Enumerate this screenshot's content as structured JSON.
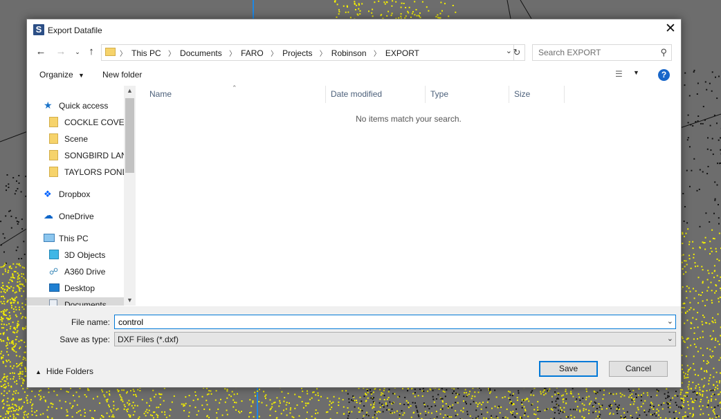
{
  "window": {
    "title": "Export Datafile",
    "app_icon_letter": "S",
    "close_glyph": "✕"
  },
  "address": {
    "crumbs": [
      "This PC",
      "Documents",
      "FARO",
      "Projects",
      "Robinson",
      "EXPORT"
    ]
  },
  "search": {
    "placeholder": "Search EXPORT"
  },
  "toolbar": {
    "organize_label": "Organize",
    "new_folder_label": "New folder",
    "help_label": "?"
  },
  "nav": {
    "items": [
      {
        "label": "Quick access",
        "icon": "star-icon"
      },
      {
        "label": "COCKLE COVE R",
        "icon": "folder-icon"
      },
      {
        "label": "Scene",
        "icon": "folder-icon"
      },
      {
        "label": "SONGBIRD LANE",
        "icon": "folder-icon"
      },
      {
        "label": "TAYLORS POND",
        "icon": "folder-icon"
      },
      {
        "label": "Dropbox",
        "icon": "dropbox-icon"
      },
      {
        "label": "OneDrive",
        "icon": "cloud-icon"
      },
      {
        "label": "This PC",
        "icon": "computer-icon"
      },
      {
        "label": "3D Objects",
        "icon": "cube-icon"
      },
      {
        "label": "A360 Drive",
        "icon": "drive-icon"
      },
      {
        "label": "Desktop",
        "icon": "desktop-icon"
      },
      {
        "label": "Documents",
        "icon": "documents-icon"
      }
    ]
  },
  "filelist": {
    "columns": [
      "Name",
      "Date modified",
      "Type",
      "Size"
    ],
    "empty_message": "No items match your search."
  },
  "form": {
    "filename_label": "File name:",
    "filename_value": "control",
    "savetype_label": "Save as type:",
    "savetype_value": "DXF Files (*.dxf)"
  },
  "footer": {
    "hide_folders_label": "Hide Folders",
    "save_label": "Save",
    "cancel_label": "Cancel"
  },
  "colors": {
    "accent": "#0078d7",
    "help": "#1866c9",
    "folder": "#f6d36b",
    "pointcloud": "#f5f000"
  }
}
